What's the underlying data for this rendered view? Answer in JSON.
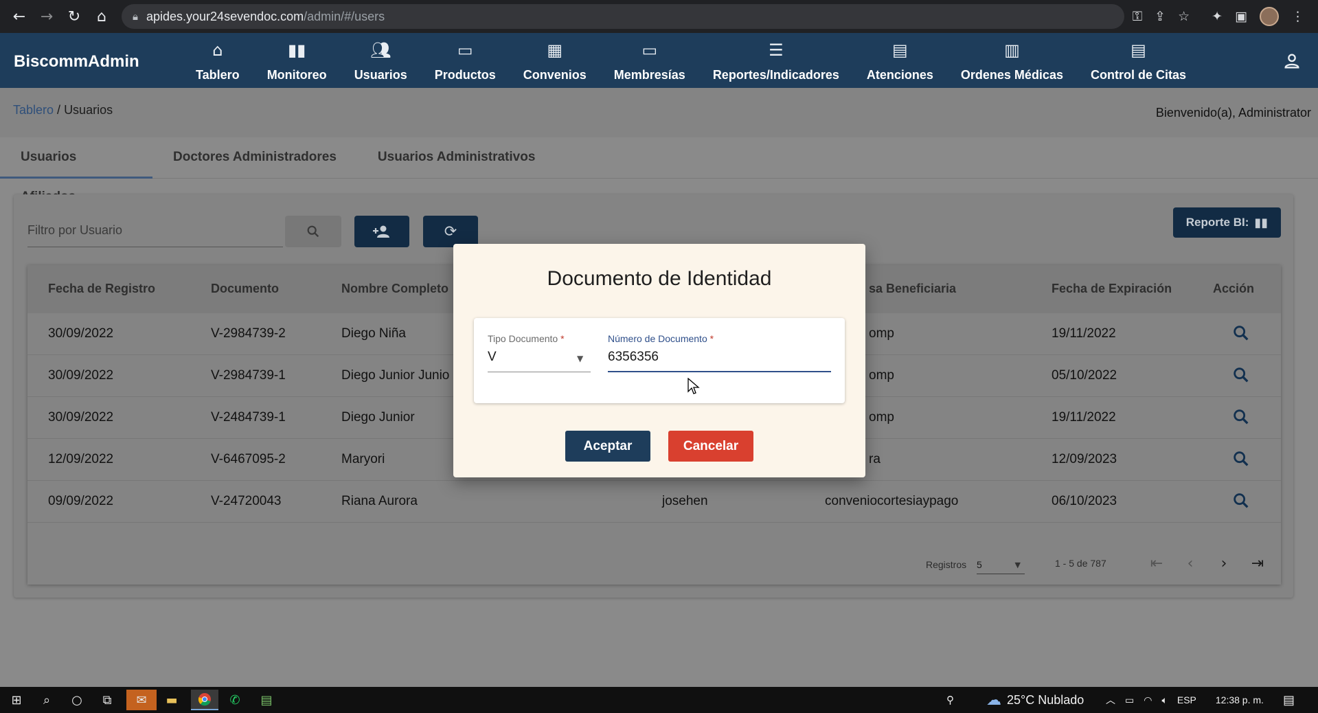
{
  "browser": {
    "url_host": "apides.your24sevendoc.com",
    "url_path": "/admin/#/users",
    "nav": {
      "back_icon": "back-arrow-icon",
      "forward_icon": "forward-arrow-icon",
      "reload_icon": "reload-icon",
      "home_icon": "home-icon"
    }
  },
  "app": {
    "brand": "BiscommAdmin",
    "menu": [
      {
        "label": "Tablero",
        "icon": "home-icon"
      },
      {
        "label": "Monitoreo",
        "icon": "bar-chart-icon"
      },
      {
        "label": "Usuarios",
        "icon": "people-icon"
      },
      {
        "label": "Productos",
        "icon": "card-icon"
      },
      {
        "label": "Convenios",
        "icon": "store-icon"
      },
      {
        "label": "Membresías",
        "icon": "card-icon"
      },
      {
        "label": "Reportes/Indicadores",
        "icon": "list-icon"
      },
      {
        "label": "Atenciones",
        "icon": "calendar-icon"
      },
      {
        "label": "Ordenes Médicas",
        "icon": "clipboard-icon"
      },
      {
        "label": "Control de Citas",
        "icon": "calendar-icon"
      }
    ]
  },
  "breadcrumb": {
    "link": "Tablero",
    "separator": " / ",
    "current": "Usuarios"
  },
  "welcome": "Bienvenido(a), Administrator",
  "tabs": [
    {
      "label": "Usuarios Afiliados",
      "active": true
    },
    {
      "label": "Doctores Administradores",
      "active": false
    },
    {
      "label": "Usuarios Administrativos",
      "active": false
    }
  ],
  "filter": {
    "placeholder": "Filtro por Usuario"
  },
  "report_button": "Reporte BI:",
  "table": {
    "headers": [
      "Fecha de Registro",
      "Documento",
      "Nombre Completo",
      "",
      "sa Beneficiaria",
      "Fecha de Expiración",
      "Acción"
    ],
    "rows": [
      {
        "fecha": "30/09/2022",
        "documento": "V-2984739-2",
        "nombre": "Diego Niña",
        "usuario": "",
        "empresa": "omp",
        "expira": "19/11/2022"
      },
      {
        "fecha": "30/09/2022",
        "documento": "V-2984739-1",
        "nombre": "Diego Junior Junio",
        "usuario": "",
        "empresa": "omp",
        "expira": "05/10/2022"
      },
      {
        "fecha": "30/09/2022",
        "documento": "V-2484739-1",
        "nombre": "Diego Junior",
        "usuario": "",
        "empresa": "omp",
        "expira": "19/11/2022"
      },
      {
        "fecha": "12/09/2022",
        "documento": "V-6467095-2",
        "nombre": "Maryori",
        "usuario": "",
        "empresa": "ra",
        "expira": "12/09/2023"
      },
      {
        "fecha": "09/09/2022",
        "documento": "V-24720043",
        "nombre": "Riana Aurora",
        "usuario": "josehen",
        "empresa": "conveniocortesiaypago",
        "expira": "06/10/2023"
      }
    ]
  },
  "paginator": {
    "label": "Registros",
    "page_size": "5",
    "range": "1 - 5 de 787"
  },
  "modal": {
    "title": "Documento de Identidad",
    "doc_type_label": "Tipo Documento",
    "doc_type_value": "V",
    "doc_number_label": "Número de Documento",
    "doc_number_value": "6356356",
    "required_mark": " *",
    "accept": "Aceptar",
    "cancel": "Cancelar"
  },
  "taskbar": {
    "weather": "25°C  Nublado",
    "language": "ESP",
    "time": "12:38 p. m."
  },
  "colors": {
    "header": "#1e3d5b",
    "accept": "#1e3d5b",
    "cancel": "#d9402f",
    "link": "#2f4f7a",
    "focus": "#2f4f8a"
  }
}
